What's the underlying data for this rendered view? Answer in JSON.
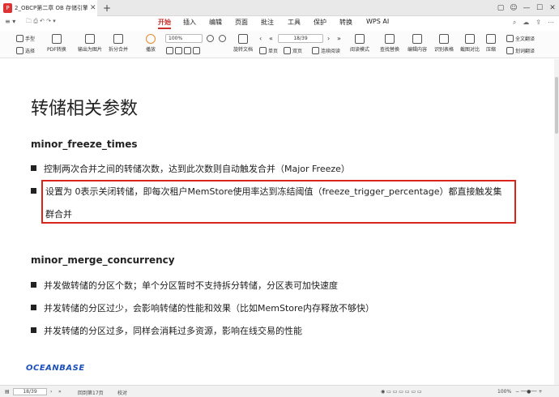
{
  "window": {
    "tab_title": "2_OBCP第二章 OB 存储引擎..."
  },
  "ribbon": {
    "tabs": [
      "开始",
      "插入",
      "编辑",
      "页面",
      "批注",
      "工具",
      "保护",
      "转换",
      "WPS AI"
    ],
    "active_tab": "开始"
  },
  "toolbar": {
    "hand_label": "手型",
    "select_label": "选择",
    "pdf_convert": "PDF转换",
    "export_image": "输出为图片",
    "split_merge": "拆分合并",
    "play": "播放",
    "zoom_value": "100%",
    "rotate_doc": "旋转文档",
    "single_page": "单页",
    "double_page": "双页",
    "continuous": "连续阅读",
    "read_mode": "阅读模式",
    "page_value": "18/39",
    "find_replace": "查找替换",
    "edit_content": "编辑内容",
    "recognize_table": "识别表格",
    "screenshot_compare": "截图对比",
    "compress": "压缩",
    "full_translate": "全文翻译",
    "word_translate": "划词翻译"
  },
  "slide": {
    "title": "转储相关参数",
    "section1": "minor_freeze_times",
    "bullets1": [
      "控制两次合并之间的转储次数，达到此次数则自动触发合并（Major Freeze）",
      "设置为 0表示关闭转储，即每次租户MemStore使用率达到冻结阈值（freeze_trigger_percentage）都直接触发集",
      "群合并"
    ],
    "section2": "minor_merge_concurrency",
    "bullets2": [
      "并发做转储的分区个数；单个分区暂时不支持拆分转储，分区表可加快速度",
      "并发转储的分区过少，会影响转储的性能和效果（比如MemStore内存释放不够快）",
      "并发转储的分区过多，同样会消耗过多资源，影响在线交易的性能"
    ],
    "logo": "OCEANBASE",
    "highlight_color": "#d9251e"
  },
  "status": {
    "page": "18/39",
    "back_to": "回到第17页",
    "proofread": "校对",
    "zoom": "100%"
  }
}
